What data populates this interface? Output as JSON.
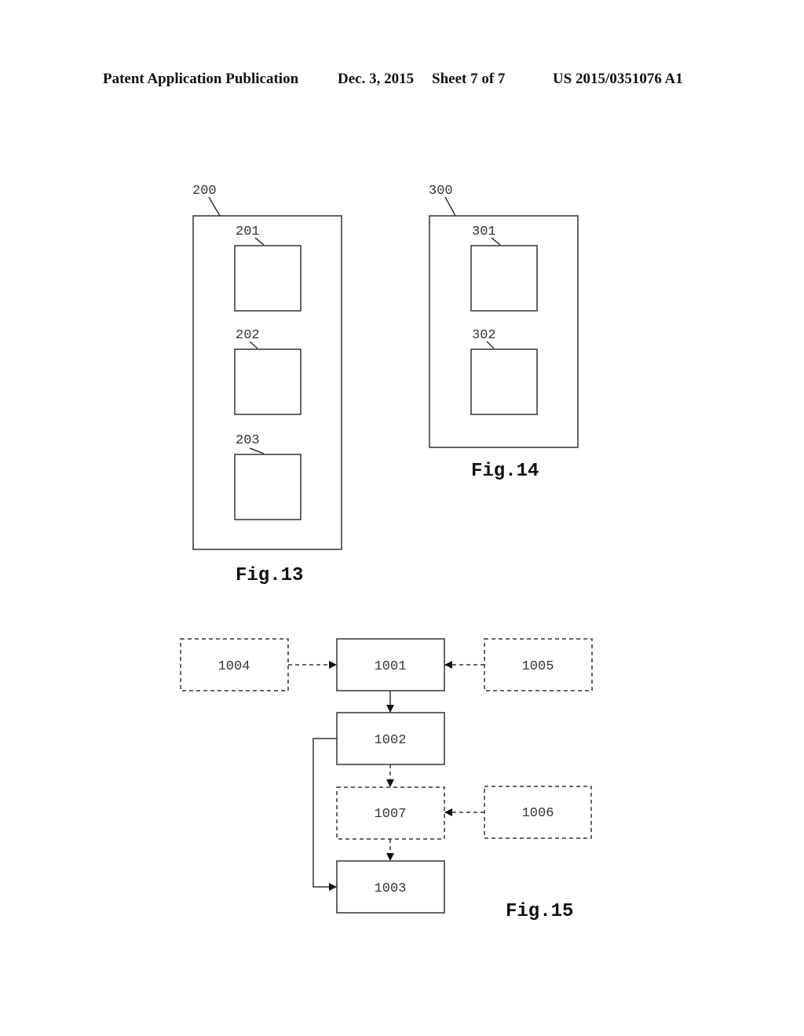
{
  "header": {
    "left": "Patent Application Publication",
    "date": "Dec. 3, 2015",
    "sheet": "Sheet 7 of 7",
    "number": "US 2015/0351076 A1"
  },
  "fig13": {
    "caption": "Fig.13",
    "outer_label": "200",
    "inner_labels": [
      "201",
      "202",
      "203"
    ]
  },
  "fig14": {
    "caption": "Fig.14",
    "outer_label": "300",
    "inner_labels": [
      "301",
      "302"
    ]
  },
  "fig15": {
    "caption": "Fig.15",
    "boxes": {
      "b1001": {
        "label": "1001",
        "style": "solid"
      },
      "b1002": {
        "label": "1002",
        "style": "solid"
      },
      "b1003": {
        "label": "1003",
        "style": "solid"
      },
      "b1004": {
        "label": "1004",
        "style": "dashed"
      },
      "b1005": {
        "label": "1005",
        "style": "dashed"
      },
      "b1006": {
        "label": "1006",
        "style": "dashed"
      },
      "b1007": {
        "label": "1007",
        "style": "dashed"
      }
    },
    "edges": [
      {
        "from": "1004",
        "to": "1001",
        "style": "dashed"
      },
      {
        "from": "1005",
        "to": "1001",
        "style": "dashed"
      },
      {
        "from": "1001",
        "to": "1002",
        "style": "solid"
      },
      {
        "from": "1002",
        "to": "1007",
        "style": "dashed"
      },
      {
        "from": "1006",
        "to": "1007",
        "style": "dashed"
      },
      {
        "from": "1007",
        "to": "1003",
        "style": "dashed"
      },
      {
        "from": "1002",
        "to": "1003",
        "style": "solid"
      }
    ]
  }
}
